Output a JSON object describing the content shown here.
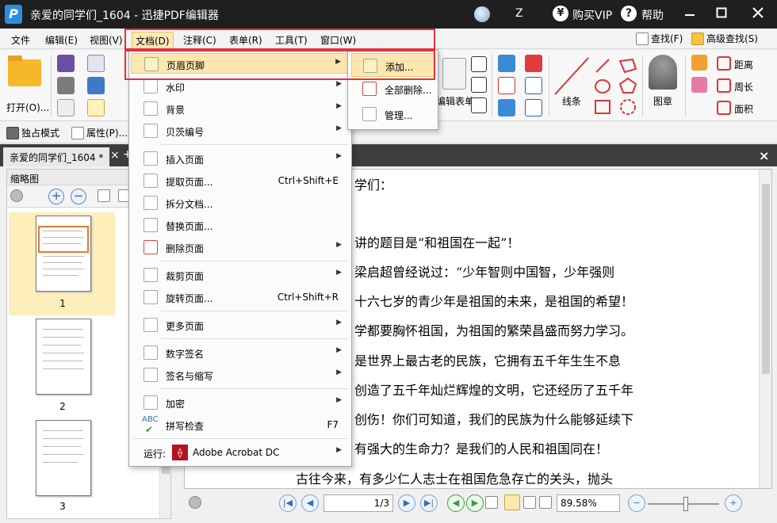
{
  "window": {
    "title": "亲爱的同学们_1604  -  迅捷PDF编辑器",
    "user": "Z",
    "vip_label": "购买VIP",
    "vip_icon_text": "¥",
    "help_label": "帮助",
    "help_icon_text": "?",
    "logo_text": "P"
  },
  "menubar": {
    "items": [
      "文件",
      "编辑(E)",
      "视图(V)",
      "文档(D)",
      "注释(C)",
      "表单(R)",
      "工具(T)",
      "窗口(W)"
    ],
    "find_label": "查找(F)",
    "advanced_find_label": "高级查找(S)"
  },
  "ribbon": {
    "open_label": "打开(O)...",
    "form_label": "编辑表单",
    "line_label": "线条",
    "stamp_label": "图章",
    "distance_label": "距离",
    "perimeter_label": "周长",
    "area_label": "面积",
    "exclusive_mode_label": "独占模式",
    "properties_label": "属性(P)..."
  },
  "tabs": {
    "doc_tab_label": "亲爱的同学们_1604 *"
  },
  "thumbnails": {
    "header": "缩略图",
    "pages": [
      "1",
      "2",
      "3"
    ]
  },
  "document": {
    "lines": [
      "学们：",
      "讲的题目是“和祖国在一起”！",
      "梁启超曾经说过：“少年智则中国智，少年强则",
      "十六七岁的青少年是祖国的未来，是祖国的希望！",
      "学都要胸怀祖国，为祖国的繁荣昌盛而努力学习。",
      "是世界上最古老的民族，它拥有五千年生生不息",
      "创造了五千年灿烂辉煌的文明，它还经历了五千年",
      "创伤！你们可知道，我们的民族为什么能够延续下",
      "有强大的生命力？是我们的人民和祖国同在！",
      "古往今来，有多少仁人志士在祖国危急存亡的关头，抛头"
    ]
  },
  "statusbar": {
    "page_value": "1/3",
    "zoom_value": "89.58%"
  },
  "document_menu": {
    "items": [
      {
        "label": "页眉页脚",
        "shortcut": "",
        "has_submenu": true,
        "highlighted": true
      },
      {
        "label": "水印",
        "shortcut": "",
        "has_submenu": true
      },
      {
        "label": "背景",
        "shortcut": "",
        "has_submenu": true
      },
      {
        "label": "贝茨编号",
        "shortcut": "",
        "has_submenu": true
      },
      {
        "label": "插入页面",
        "shortcut": "",
        "has_submenu": true
      },
      {
        "label": "提取页面...",
        "shortcut": "Ctrl+Shift+E",
        "has_submenu": false
      },
      {
        "label": "拆分文档...",
        "shortcut": "",
        "has_submenu": false
      },
      {
        "label": "替换页面...",
        "shortcut": "",
        "has_submenu": false
      },
      {
        "label": "删除页面",
        "shortcut": "",
        "has_submenu": true
      },
      {
        "label": "裁剪页面",
        "shortcut": "",
        "has_submenu": true
      },
      {
        "label": "旋转页面...",
        "shortcut": "Ctrl+Shift+R",
        "has_submenu": false
      },
      {
        "label": "更多页面",
        "shortcut": "",
        "has_submenu": true
      },
      {
        "label": "数字签名",
        "shortcut": "",
        "has_submenu": true
      },
      {
        "label": "签名与缩写",
        "shortcut": "",
        "has_submenu": true
      },
      {
        "label": "加密",
        "shortcut": "",
        "has_submenu": true
      },
      {
        "label": "拼写检查",
        "shortcut": "F7",
        "has_submenu": false
      },
      {
        "label": "运行:",
        "app": "Adobe Acrobat DC",
        "has_submenu": true
      }
    ],
    "spell_icon_text": "ABC"
  },
  "header_footer_submenu": {
    "items": [
      "添加...",
      "全部删除...",
      "管理..."
    ]
  },
  "colors": {
    "titlebar": "#1f1f1f",
    "highlight": "#fde7b0",
    "highlight_border": "#f0c86a",
    "red_annotation": "#e2323a",
    "accent_blue": "#2b8de0"
  }
}
